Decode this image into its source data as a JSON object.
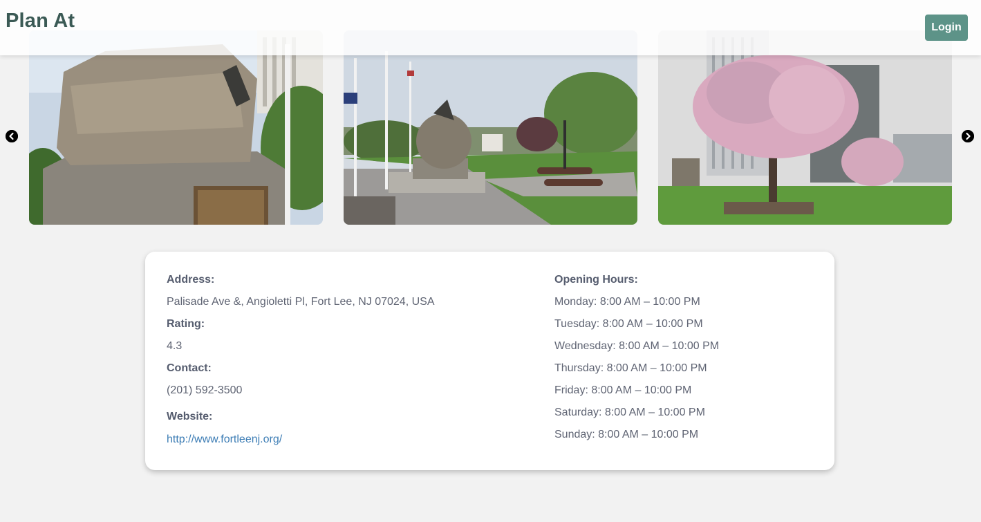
{
  "header": {
    "brand": "Plan At",
    "login_label": "Login"
  },
  "carousel": {
    "prev_icon": "chevron-left-circle-icon",
    "next_icon": "chevron-right-circle-icon"
  },
  "details": {
    "address_label": "Address:",
    "address_value": "Palisade Ave &, Angioletti Pl, Fort Lee, NJ 07024, USA",
    "rating_label": "Rating:",
    "rating_value": "4.3",
    "contact_label": "Contact:",
    "contact_value": "(201) 592-3500",
    "website_label": "Website:",
    "website_value": "http://www.fortleenj.org/"
  },
  "hours": {
    "label": "Opening Hours:",
    "days": [
      "Monday: 8:00 AM – 10:00 PM",
      "Tuesday: 8:00 AM – 10:00 PM",
      "Wednesday: 8:00 AM – 10:00 PM",
      "Thursday: 8:00 AM – 10:00 PM",
      "Friday: 8:00 AM – 10:00 PM",
      "Saturday: 8:00 AM – 10:00 PM",
      "Sunday: 8:00 AM – 10:00 PM"
    ]
  },
  "colors": {
    "brand_text": "#3b5a55",
    "login_button": "#5d9388",
    "link": "#3d7db5",
    "background": "#f2f2f2"
  }
}
